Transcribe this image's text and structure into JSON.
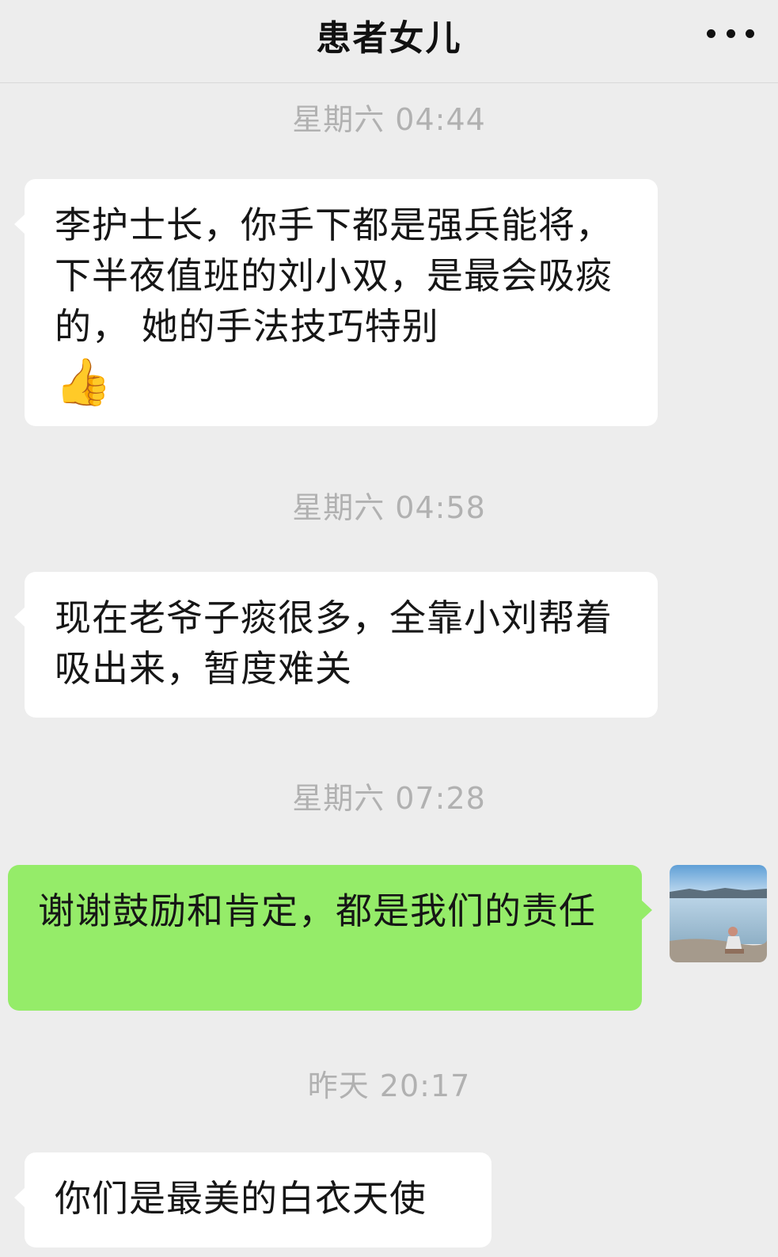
{
  "header": {
    "title": "患者女儿",
    "more_icon": "more-icon"
  },
  "messages": [
    {
      "time": "星期六 04:44",
      "text": "李护士长，你手下都是强兵能将，下半夜值班的刘小双，是最会吸痰的， 她的手法技巧特别",
      "emoji": "👍"
    },
    {
      "time": "星期六 04:58",
      "text": "现在老爷子痰很多，全靠小刘帮着吸出来，暂度难关"
    },
    {
      "time": "星期六 07:28",
      "text": "谢谢鼓励和肯定，都是我们的责任",
      "avatar_icon": "lake-photo-avatar"
    },
    {
      "time": "昨天 20:17",
      "text": "你们是最美的白衣天使"
    }
  ],
  "colors": {
    "background": "#ededed",
    "incoming_bubble": "#ffffff",
    "outgoing_bubble": "#95ec69",
    "timestamp": "#b1b1b1"
  }
}
